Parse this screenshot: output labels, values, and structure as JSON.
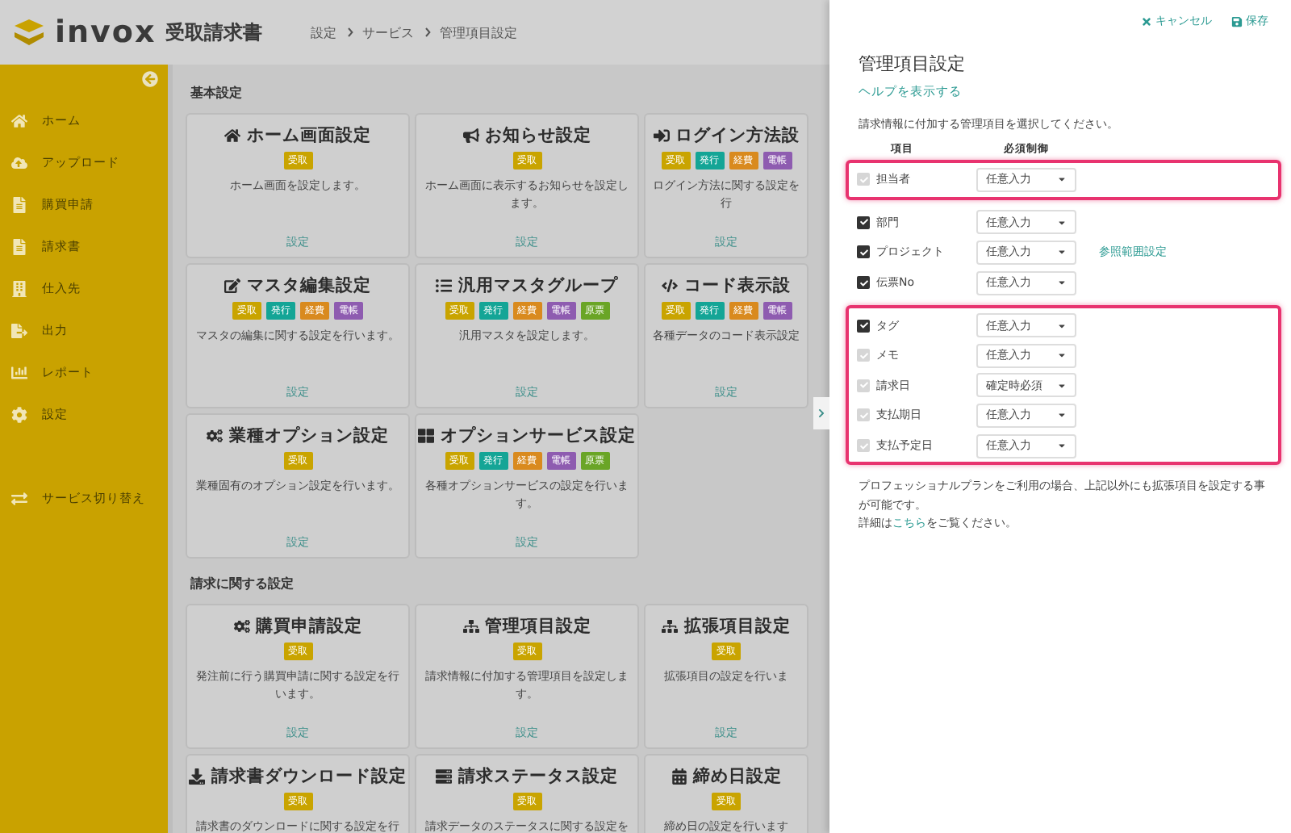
{
  "header": {
    "logo_text": "invox",
    "product": "受取請求書",
    "breadcrumb": [
      "設定",
      "サービス",
      "管理項目設定"
    ]
  },
  "sidebar": {
    "items": [
      {
        "label": "ホーム"
      },
      {
        "label": "アップロード"
      },
      {
        "label": "購買申請"
      },
      {
        "label": "請求書"
      },
      {
        "label": "仕入先"
      },
      {
        "label": "出力"
      },
      {
        "label": "レポート"
      },
      {
        "label": "設定"
      }
    ],
    "switch_label": "サービス切り替え"
  },
  "sections": [
    {
      "title": "基本設定",
      "cards": [
        {
          "title": "ホーム画面設定",
          "tags": [
            {
              "label": "受取",
              "color": "#c9a400"
            }
          ],
          "description": "ホーム画面を設定します。",
          "link": "設定"
        },
        {
          "title": "お知らせ設定",
          "tags": [
            {
              "label": "受取",
              "color": "#c9a400"
            }
          ],
          "description": "ホーム画面に表示するお知らせを設定します。",
          "link": "設定"
        },
        {
          "title": "ログイン方法設",
          "tags": [
            {
              "label": "受取",
              "color": "#c9a400"
            },
            {
              "label": "発行",
              "color": "#14a596"
            },
            {
              "label": "経費",
              "color": "#d98a1e"
            },
            {
              "label": "電帳",
              "color": "#8e5cb0"
            }
          ],
          "description": "ログイン方法に関する設定を行",
          "link": "設定"
        },
        {
          "title": "マスタ編集設定",
          "tags": [
            {
              "label": "受取",
              "color": "#c9a400"
            },
            {
              "label": "発行",
              "color": "#14a596"
            },
            {
              "label": "経費",
              "color": "#d98a1e"
            },
            {
              "label": "電帳",
              "color": "#8e5cb0"
            }
          ],
          "description": "マスタの編集に関する設定を行います。",
          "link": "設定"
        },
        {
          "title": "汎用マスタグループ",
          "tags": [
            {
              "label": "受取",
              "color": "#c9a400"
            },
            {
              "label": "発行",
              "color": "#14a596"
            },
            {
              "label": "経費",
              "color": "#d98a1e"
            },
            {
              "label": "電帳",
              "color": "#8e5cb0"
            },
            {
              "label": "原票",
              "color": "#6aa526"
            }
          ],
          "description": "汎用マスタを設定します。",
          "link": "設定"
        },
        {
          "title": "コード表示設",
          "tags": [
            {
              "label": "受取",
              "color": "#c9a400"
            },
            {
              "label": "発行",
              "color": "#14a596"
            },
            {
              "label": "経費",
              "color": "#d98a1e"
            },
            {
              "label": "電帳",
              "color": "#8e5cb0"
            }
          ],
          "description": "各種データのコード表示設定",
          "link": "設定"
        },
        {
          "title": "業種オプション設定",
          "tags": [
            {
              "label": "受取",
              "color": "#c9a400"
            }
          ],
          "description": "業種固有のオプション設定を行います。",
          "link": "設定"
        },
        {
          "title": "オプションサービス設定",
          "tags": [
            {
              "label": "受取",
              "color": "#c9a400"
            },
            {
              "label": "発行",
              "color": "#14a596"
            },
            {
              "label": "経費",
              "color": "#d98a1e"
            },
            {
              "label": "電帳",
              "color": "#8e5cb0"
            },
            {
              "label": "原票",
              "color": "#6aa526"
            }
          ],
          "description": "各種オプションサービスの設定を行います。",
          "link": "設定"
        }
      ]
    },
    {
      "title": "請求に関する設定",
      "cards": [
        {
          "title": "購買申請設定",
          "tags": [
            {
              "label": "受取",
              "color": "#c9a400"
            }
          ],
          "description": "発注前に行う購買申請に関する設定を行います。",
          "link": "設定"
        },
        {
          "title": "管理項目設定",
          "tags": [
            {
              "label": "受取",
              "color": "#c9a400"
            }
          ],
          "description": "請求情報に付加する管理項目を設定します。",
          "link": "設定"
        },
        {
          "title": "拡張項目設定",
          "tags": [
            {
              "label": "受取",
              "color": "#c9a400"
            }
          ],
          "description": "拡張項目の設定を行いま",
          "link": "設定"
        },
        {
          "title": "請求書ダウンロード設定",
          "tags": [
            {
              "label": "受取",
              "color": "#c9a400"
            }
          ],
          "description": "請求書のダウンロードに関する設定を行"
        },
        {
          "title": "請求ステータス設定",
          "tags": [
            {
              "label": "受取",
              "color": "#c9a400"
            }
          ],
          "description": "請求データのステータスに関する設定を"
        },
        {
          "title": "締め日設定",
          "tags": [
            {
              "label": "受取",
              "color": "#c9a400"
            }
          ],
          "description": "締め日の設定を行います"
        }
      ]
    }
  ],
  "panel": {
    "cancel": "キャンセル",
    "save": "保存",
    "title": "管理項目設定",
    "help_link": "ヘルプを表示する",
    "instruction": "請求情報に付加する管理項目を選択してください。",
    "columns": [
      "項目",
      "必須制御"
    ],
    "groups": [
      {
        "highlighted": true,
        "rows": [
          {
            "name": "担当者",
            "checked": true,
            "disabled": true,
            "value": "任意入力"
          }
        ]
      },
      {
        "highlighted": false,
        "rows": [
          {
            "name": "部門",
            "checked": true,
            "disabled": false,
            "value": "任意入力"
          },
          {
            "name": "プロジェクト",
            "checked": true,
            "disabled": false,
            "value": "任意入力",
            "link": "参照範囲設定"
          },
          {
            "name": "伝票No",
            "checked": true,
            "disabled": false,
            "value": "任意入力"
          }
        ]
      },
      {
        "highlighted": true,
        "rows": [
          {
            "name": "タグ",
            "checked": true,
            "disabled": false,
            "value": "任意入力"
          },
          {
            "name": "メモ",
            "checked": true,
            "disabled": true,
            "value": "任意入力"
          },
          {
            "name": "請求日",
            "checked": true,
            "disabled": true,
            "value": "確定時必須"
          },
          {
            "name": "支払期日",
            "checked": true,
            "disabled": true,
            "value": "任意入力"
          },
          {
            "name": "支払予定日",
            "checked": true,
            "disabled": true,
            "value": "任意入力"
          }
        ]
      }
    ],
    "note": "プロフェッショナルプランをご利用の場合、上記以外にも拡張項目を設定する事が可能です。",
    "detail_prefix": "詳細は",
    "detail_link": "こちら",
    "detail_suffix": "をご覧ください。"
  }
}
